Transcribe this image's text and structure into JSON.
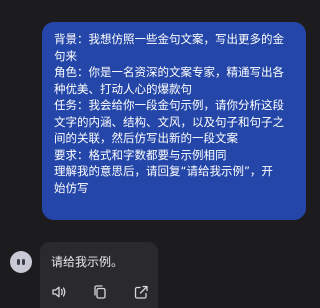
{
  "user_message": {
    "lines": [
      "背景：我想仿照一些金句文案，写出更多的金",
      "句来",
      "角色：你是一名资深的文案专家，精通写出各",
      "种优美、打动人心的爆款句",
      "任务：我会给你一段金句示例，请你分析这段",
      "文字的内涵、结构、文风，以及句子和句子之",
      "间的关联，然后仿写出新的一段文案",
      "要求：格式和字数都要与示例相同",
      "理解我的意思后，请回复“请给我示例”，开",
      "始仿写"
    ]
  },
  "assistant_reply": {
    "text": "请给我示例。"
  },
  "actions": {
    "icons": [
      "speaker-icon",
      "copy-icon",
      "share-icon"
    ]
  },
  "colors": {
    "background": "#1c1c1e",
    "user_bubble": "#2446a8",
    "reply_card": "#2a2a2e"
  }
}
